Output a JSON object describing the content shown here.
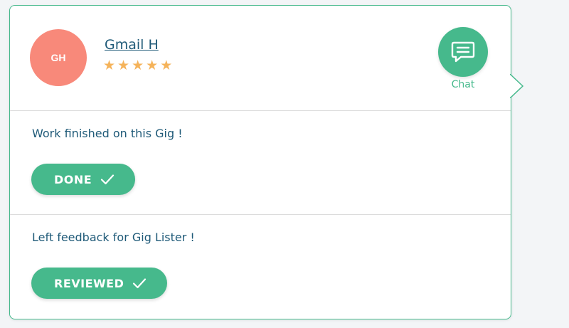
{
  "user": {
    "initials": "GH",
    "name": "Gmail H",
    "rating": 5,
    "stars": [
      "★",
      "★",
      "★",
      "★",
      "★"
    ]
  },
  "chat": {
    "label": "Chat",
    "icon": "chat-bubble-icon"
  },
  "steps": [
    {
      "text": "Work finished on this Gig !",
      "button_label": "DONE",
      "icon": "check-icon"
    },
    {
      "text": "Left feedback for Gig Lister !",
      "button_label": "REVIEWED",
      "icon": "check-icon"
    }
  ],
  "colors": {
    "accent": "#46b98c",
    "avatar": "#f8897a",
    "text": "#1f5a78",
    "star": "#f5b35a"
  }
}
